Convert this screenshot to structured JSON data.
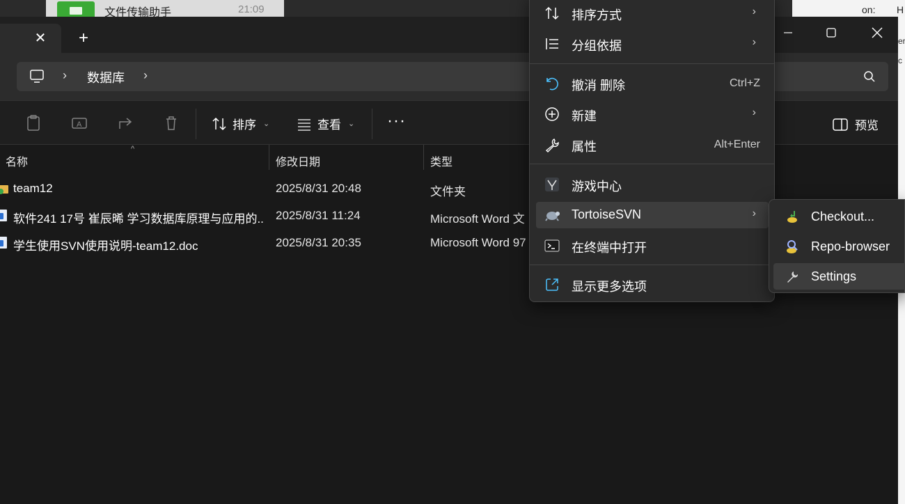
{
  "background": {
    "chat_title": "文件传输助手",
    "chat_time": "21:09",
    "right_text": "on:",
    "right_h": "H",
    "edge_text": [
      "er",
      "c"
    ]
  },
  "window": {
    "tab_close_glyph": "✕",
    "tab_new_glyph": "+",
    "controls": {
      "minimize": "—",
      "maximize": "☐",
      "close": "✕"
    }
  },
  "address": {
    "crumbs": [
      "数据库"
    ],
    "chevron": "›"
  },
  "toolbar": {
    "sort_label": "排序",
    "view_label": "查看",
    "more_label": "···",
    "preview_label": "预览",
    "caret": "⌄"
  },
  "columns": {
    "name": "名称",
    "modified": "修改日期",
    "type": "类型",
    "sort_indicator": "^"
  },
  "files": [
    {
      "name": "team12",
      "modified": "2025/8/31 20:48",
      "type": "文件夹",
      "icon": "folder-svn-icon"
    },
    {
      "name": "软件241 17号 崔辰晞 学习数据库原理与应用的...",
      "modified": "2025/8/31 11:24",
      "type": "Microsoft Word 文",
      "icon": "word-doc-icon"
    },
    {
      "name": "学生使用SVN使用说明-team12.doc",
      "modified": "2025/8/31 20:35",
      "type": "Microsoft Word 97",
      "icon": "word-doc-icon"
    }
  ],
  "context_menu": {
    "items": [
      {
        "label": "排序方式",
        "shortcut": "",
        "arrow": "›",
        "icon": "sort-icon"
      },
      {
        "label": "分组依据",
        "shortcut": "",
        "arrow": "›",
        "icon": "group-by-icon"
      },
      {
        "label": "撤消 删除",
        "shortcut": "Ctrl+Z",
        "arrow": "",
        "icon": "undo-icon"
      },
      {
        "label": "新建",
        "shortcut": "",
        "arrow": "›",
        "icon": "new-icon"
      },
      {
        "label": "属性",
        "shortcut": "Alt+Enter",
        "arrow": "",
        "icon": "wrench-icon"
      },
      {
        "label": "游戏中心",
        "shortcut": "",
        "arrow": "",
        "icon": "game-center-icon"
      },
      {
        "label": "TortoiseSVN",
        "shortcut": "",
        "arrow": "›",
        "icon": "tortoise-svn-icon"
      },
      {
        "label": "在终端中打开",
        "shortcut": "",
        "arrow": "",
        "icon": "terminal-icon"
      },
      {
        "label": "显示更多选项",
        "shortcut": "",
        "arrow": "",
        "icon": "show-more-icon"
      }
    ]
  },
  "svn_submenu": {
    "items": [
      {
        "label": "Checkout...",
        "icon": "checkout-icon"
      },
      {
        "label": "Repo-browser",
        "icon": "repo-browser-icon"
      },
      {
        "label": "Settings",
        "icon": "settings-wrench-icon"
      }
    ]
  },
  "colors": {
    "accent": "#4cc2ff",
    "menu_bg": "#2b2b2b",
    "window_bg": "#191919"
  }
}
